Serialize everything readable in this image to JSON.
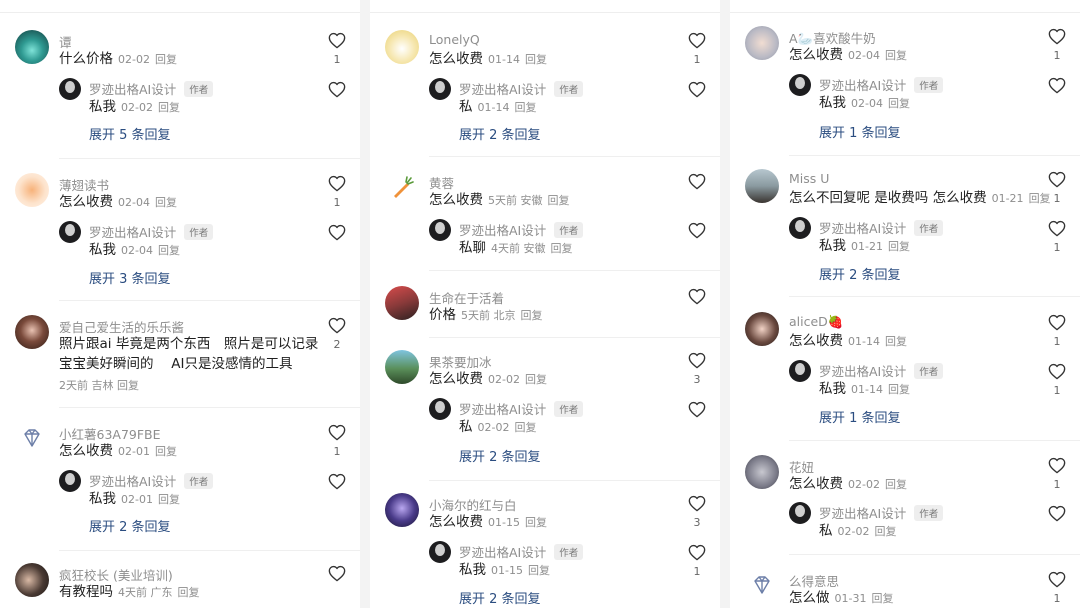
{
  "columns": [
    {
      "comments": [
        {
          "name": "谭",
          "text": "什么价格",
          "date": "02-02",
          "reply_label": "回复",
          "likes": "1",
          "avatar": "teal",
          "reply": {
            "name": "罗迹出格AI设计",
            "tag": "作者",
            "text": "私我",
            "date": "02-02",
            "reply_label": "回复"
          },
          "expand": "展开 5 条回复"
        },
        {
          "name": "薄翅读书",
          "text": "怎么收费",
          "date": "02-04",
          "reply_label": "回复",
          "likes": "1",
          "avatar": "orange",
          "reply": {
            "name": "罗迹出格AI设计",
            "tag": "作者",
            "text": "私我",
            "date": "02-04",
            "reply_label": "回复"
          },
          "expand": "展开 3 条回复"
        },
        {
          "name": "爱自己爱生活的乐乐酱",
          "text_lines": [
            "照片跟ai 毕竟是两个东西　照片是可以记录",
            "宝宝美好瞬间的　 AI只是没感情的工具"
          ],
          "meta": "2天前 吉林 回复",
          "likes": "2",
          "avatar": "portrait"
        },
        {
          "name": "小红薯63A79FBE",
          "text": "怎么收费",
          "date": "02-01",
          "reply_label": "回复",
          "likes": "1",
          "avatar": "diamond",
          "reply": {
            "name": "罗迹出格AI设计",
            "tag": "作者",
            "text": "私我",
            "date": "02-01",
            "reply_label": "回复"
          },
          "expand": "展开 2 条回复"
        },
        {
          "name": "疯狂校长 (美业培训)",
          "text": "有教程吗",
          "date": "4天前 广东",
          "reply_label": "回复",
          "likes": "",
          "avatar": "duo"
        }
      ]
    },
    {
      "comments": [
        {
          "name": "LonelyQ",
          "text": "怎么收费",
          "date": "01-14",
          "reply_label": "回复",
          "likes": "1",
          "avatar": "cartoon",
          "reply": {
            "name": "罗迹出格AI设计",
            "tag": "作者",
            "text": "私",
            "date": "01-14",
            "reply_label": "回复"
          },
          "expand": "展开 2 条回复"
        },
        {
          "name": "黄蓉",
          "text": "怎么收费",
          "date": "5天前 安徽",
          "reply_label": "回复",
          "likes": "",
          "avatar": "carrot",
          "reply": {
            "name": "罗迹出格AI设计",
            "tag": "作者",
            "text": "私聊",
            "date": "4天前 安徽",
            "reply_label": "回复"
          }
        },
        {
          "name": "生命在于活着",
          "text": "价格",
          "date": "5天前 北京",
          "reply_label": "回复",
          "likes": "",
          "avatar": "city"
        },
        {
          "name": "果茶要加冰",
          "text": "怎么收费",
          "date": "02-02",
          "reply_label": "回复",
          "likes": "3",
          "avatar": "landscape",
          "reply": {
            "name": "罗迹出格AI设计",
            "tag": "作者",
            "text": "私",
            "date": "02-02",
            "reply_label": "回复"
          },
          "expand": "展开 2 条回复"
        },
        {
          "name": "小海尔的红与白",
          "text": "怎么收费",
          "date": "01-15",
          "reply_label": "回复",
          "likes": "3",
          "avatar": "purple",
          "reply": {
            "name": "罗迹出格AI设计",
            "tag": "作者",
            "text": "私我",
            "date": "01-15",
            "reply_label": "回复",
            "likes": "1"
          },
          "expand": "展开 2 条回复"
        }
      ]
    },
    {
      "comments": [
        {
          "name": "A🦢喜欢酸牛奶",
          "text": "怎么收费",
          "date": "02-04",
          "reply_label": "回复",
          "likes": "1",
          "avatar": "kid",
          "reply": {
            "name": "罗迹出格AI设计",
            "tag": "作者",
            "text": "私我",
            "date": "02-04",
            "reply_label": "回复"
          },
          "expand": "展开 1 条回复"
        },
        {
          "name": "Miss U",
          "text": "怎么不回复呢 是收费吗 怎么收费",
          "date": "01-21",
          "reply_label": "回复",
          "likes": "1",
          "avatar": "beach",
          "reply": {
            "name": "罗迹出格AI设计",
            "tag": "作者",
            "text": "私我",
            "date": "01-21",
            "reply_label": "回复",
            "likes": "1"
          },
          "expand": "展开 2 条回复"
        },
        {
          "name": "aliceD🍓",
          "text": "怎么收费",
          "date": "01-14",
          "reply_label": "回复",
          "likes": "1",
          "avatar": "girl",
          "reply": {
            "name": "罗迹出格AI设计",
            "tag": "作者",
            "text": "私我",
            "date": "01-14",
            "reply_label": "回复",
            "likes": "1"
          },
          "expand": "展开 1 条回复"
        },
        {
          "name": "花妞",
          "text": "怎么收费",
          "date": "02-02",
          "reply_label": "回复",
          "likes": "1",
          "avatar": "gray",
          "reply": {
            "name": "罗迹出格AI设计",
            "tag": "作者",
            "text": "私",
            "date": "02-02",
            "reply_label": "回复"
          }
        },
        {
          "name": "么得意思",
          "text": "怎么做",
          "date": "01-31",
          "reply_label": "回复",
          "likes": "1",
          "avatar": "diamond"
        }
      ]
    }
  ],
  "colors": {
    "link": "#2b4d80",
    "meta": "#8e8e8e",
    "text": "#1f1f1f",
    "tag_bg": "#eeeeee"
  },
  "icons": {
    "like": "heart-outline-icon",
    "verified_avatar": "diamond-icon"
  }
}
